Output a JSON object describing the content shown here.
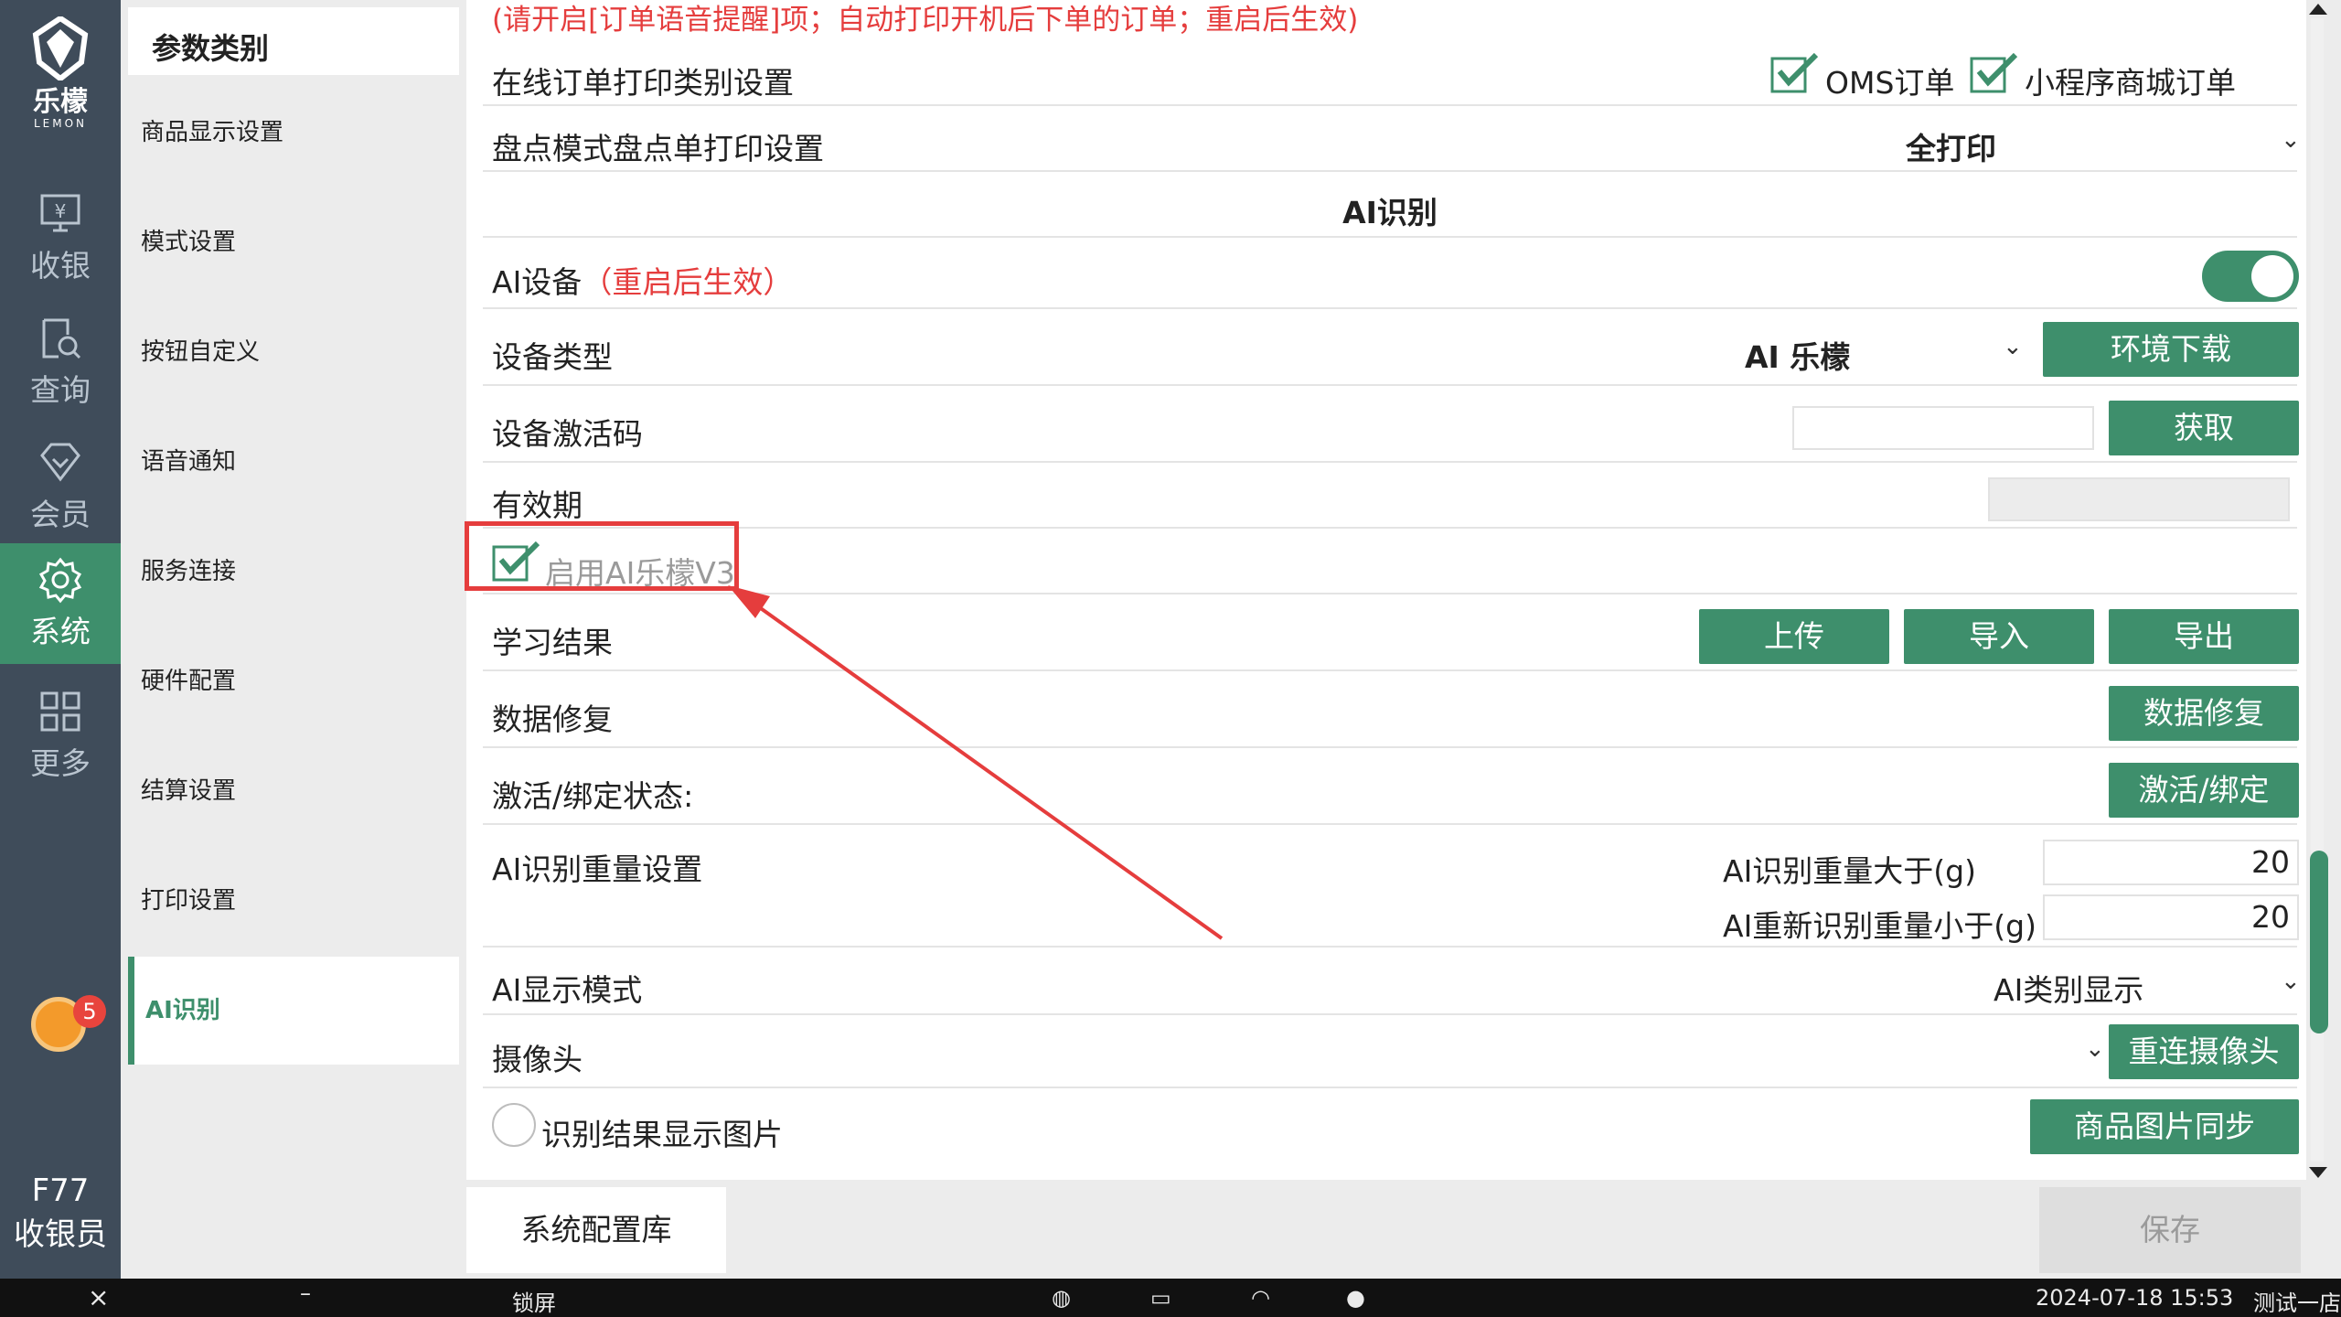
{
  "app": {
    "logo_name": "乐檬",
    "logo_sub": "LEMON"
  },
  "rail": {
    "items": [
      {
        "label": "收银",
        "icon": "cashier-icon"
      },
      {
        "label": "查询",
        "icon": "query-icon"
      },
      {
        "label": "会员",
        "icon": "member-icon"
      },
      {
        "label": "系统",
        "icon": "gear-icon",
        "active": true
      },
      {
        "label": "更多",
        "icon": "grid-icon"
      }
    ],
    "notification_count": "5",
    "user_id": "F77",
    "user_role": "收银员"
  },
  "categories": {
    "header": "参数类别",
    "items": [
      "商品显示设置",
      "模式设置",
      "按钮自定义",
      "语音通知",
      "服务连接",
      "硬件配置",
      "结算设置",
      "打印设置",
      "AI识别"
    ],
    "active": "AI识别"
  },
  "settings": {
    "top_note": "(请开启[订单语音提醒]项；自动打印开机后下单的订单；重启后生效)",
    "online_print_label": "在线订单打印类别设置",
    "oms_label": "OMS订单",
    "oms_checked": true,
    "mini_label": "小程序商城订单",
    "mini_checked": true,
    "inventory_print_label": "盘点模式盘点单打印设置",
    "inventory_print_value": "全打印",
    "section_title": "AI识别",
    "ai_device_label": "AI设备",
    "ai_device_note": "（重启后生效）",
    "ai_device_on": true,
    "device_type_label": "设备类型",
    "device_type_value": "AI 乐檬",
    "env_download_btn": "环境下载",
    "activation_code_label": "设备激活码",
    "activation_code_value": "",
    "get_btn": "获取",
    "validity_label": "有效期",
    "validity_value": "",
    "enable_v3_label": "启用AI乐檬V3",
    "enable_v3_checked": true,
    "learn_result_label": "学习结果",
    "upload_btn": "上传",
    "import_btn": "导入",
    "export_btn": "导出",
    "data_repair_label": "数据修复",
    "data_repair_btn": "数据修复",
    "activate_status_label": "激活/绑定状态:",
    "activate_btn": "激活/绑定",
    "weight_label": "AI识别重量设置",
    "weight_gt_label": "AI识别重量大于(g)",
    "weight_gt_value": "20",
    "weight_lt_label": "AI重新识别重量小于(g)",
    "weight_lt_value": "20",
    "display_mode_label": "AI显示模式",
    "display_mode_value": "AI类别显示",
    "camera_label": "摄像头",
    "camera_value": "",
    "reconnect_btn": "重连摄像头",
    "show_image_label": "识别结果显示图片",
    "show_image_checked": false,
    "sync_image_btn": "商品图片同步"
  },
  "footer": {
    "config_btn": "系统配置库",
    "save_btn": "保存"
  },
  "taskbar": {
    "lock": "锁屏",
    "datetime": "2024-07-18 15:53",
    "store": "测试一店"
  },
  "colors": {
    "accent": "#3e8f6c",
    "rail_bg": "#3f4c5a",
    "warning": "#e53d3d"
  }
}
